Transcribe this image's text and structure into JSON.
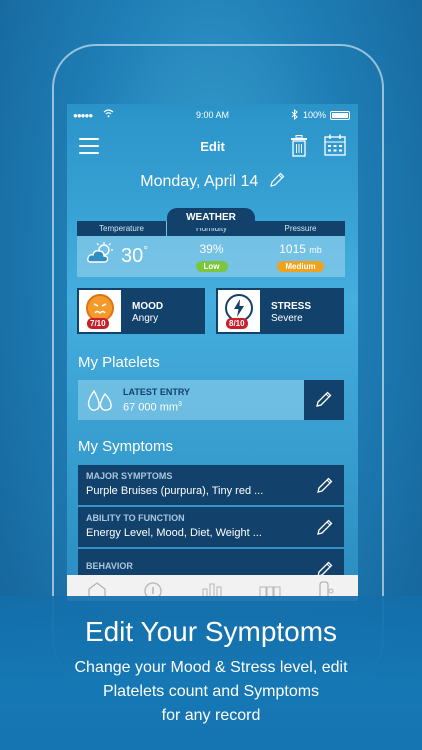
{
  "status_bar": {
    "signal": "●●●●●",
    "time": "9:00 AM",
    "battery": "100%"
  },
  "nav": {
    "title": "Edit",
    "menu_icon": "hamburger-icon",
    "trash_icon": "trash-icon",
    "calendar_icon": "calendar-icon"
  },
  "date": {
    "text": "Monday, April 14"
  },
  "weather": {
    "header": "WEATHER",
    "temperature_label": "Temperature",
    "temperature_value": "30",
    "temperature_unit": "°",
    "humidity_label": "Humidity",
    "humidity_value": "39%",
    "humidity_badge": "Low",
    "pressure_label": "Pressure",
    "pressure_value": "1015",
    "pressure_unit": "mb",
    "pressure_badge": "Medium"
  },
  "mood": {
    "title": "MOOD",
    "value": "Angry",
    "score": "7/10"
  },
  "stress": {
    "title": "STRESS",
    "value": "Severe",
    "score": "8/10"
  },
  "platelets": {
    "section_title": "My Platelets",
    "label": "LATEST ENTRY",
    "value": "67 000 mm",
    "unit_sup": "3"
  },
  "symptoms": {
    "section_title": "My Symptoms",
    "items": [
      {
        "heading": "MAJOR SYMPTOMS",
        "text": "Purple Bruises (purpura), Tiny red ..."
      },
      {
        "heading": "ABILITY TO FUNCTION",
        "text": "Energy Level, Mood, Diet, Weight ..."
      },
      {
        "heading": "BEHAVIOR",
        "text": ""
      }
    ]
  },
  "promo": {
    "headline": "Edit Your Symptoms",
    "line1": "Change your Mood & Stress level, edit",
    "line2": "Platelets count  and Symptoms",
    "line3": "for any record"
  },
  "colors": {
    "dark_navy": "#12416b",
    "low_badge": "#7cc63d",
    "medium_badge": "#f0a21c",
    "score_red": "#c8202a"
  }
}
